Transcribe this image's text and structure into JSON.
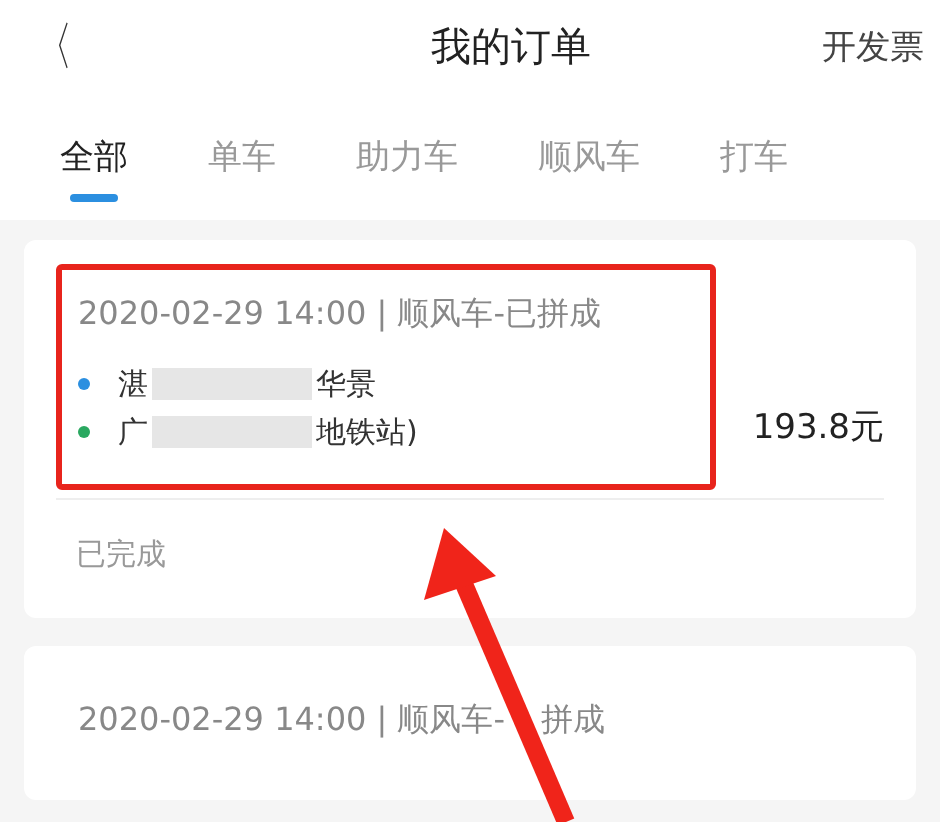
{
  "header": {
    "back": "〈",
    "title": "我的订单",
    "action": "开发票"
  },
  "tabs": [
    {
      "label": "全部",
      "selected": true
    },
    {
      "label": "单车",
      "selected": false
    },
    {
      "label": "助力车",
      "selected": false
    },
    {
      "label": "顺风车",
      "selected": false
    },
    {
      "label": "打车",
      "selected": false
    }
  ],
  "orders": [
    {
      "meta": "2020-02-29 14:00 | 顺风车-已拼成",
      "stops": [
        {
          "start": "湛",
          "end": "华景",
          "color": "#2b8fe0"
        },
        {
          "start": "广",
          "end": "地铁站)",
          "color": "#2aa860"
        }
      ],
      "price": "193.8元",
      "status": "已完成",
      "highlighted": true
    },
    {
      "meta": "2020-02-29 14:00 | 顺风车-",
      "meta_tail": "拼成",
      "highlighted": false
    }
  ]
}
